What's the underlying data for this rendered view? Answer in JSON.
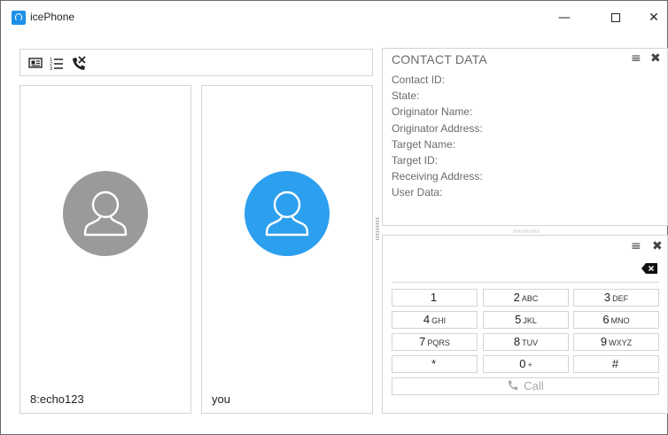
{
  "app": {
    "title": "icePhone",
    "icon": "headset-icon"
  },
  "window_controls": {
    "minimize": "—",
    "close": "✕"
  },
  "toolbar": {
    "icons": [
      "contact-card-icon",
      "list-icon",
      "hangup-icon"
    ]
  },
  "participants": [
    {
      "name": "8:echo123",
      "avatar_color": "#9a9a9a"
    },
    {
      "name": "you",
      "avatar_color": "#2d9fef"
    }
  ],
  "contact_panel": {
    "title": "CONTACT DATA",
    "menu_glyph": "≡",
    "close_glyph": "✖",
    "fields": [
      "Contact ID:",
      "State:",
      "Originator Name:",
      "Originator Address:",
      "Target Name:",
      "Target ID:",
      "Receiving Address:",
      "User Data:"
    ]
  },
  "dialpad": {
    "menu_glyph": "≡",
    "close_glyph": "✖",
    "keys": [
      {
        "digit": "1",
        "letters": ""
      },
      {
        "digit": "2",
        "letters": "ABC"
      },
      {
        "digit": "3",
        "letters": "DEF"
      },
      {
        "digit": "4",
        "letters": "GHI"
      },
      {
        "digit": "5",
        "letters": "JKL"
      },
      {
        "digit": "6",
        "letters": "MNO"
      },
      {
        "digit": "7",
        "letters": "PQRS"
      },
      {
        "digit": "8",
        "letters": "TUV"
      },
      {
        "digit": "9",
        "letters": "WXYZ"
      },
      {
        "digit": "*",
        "letters": ""
      },
      {
        "digit": "0",
        "letters": "+"
      },
      {
        "digit": "#",
        "letters": ""
      }
    ],
    "call_label": "Call"
  },
  "colors": {
    "accent": "#2d9fef",
    "border": "#d4d4d4",
    "muted_text": "#6b6b6b"
  }
}
